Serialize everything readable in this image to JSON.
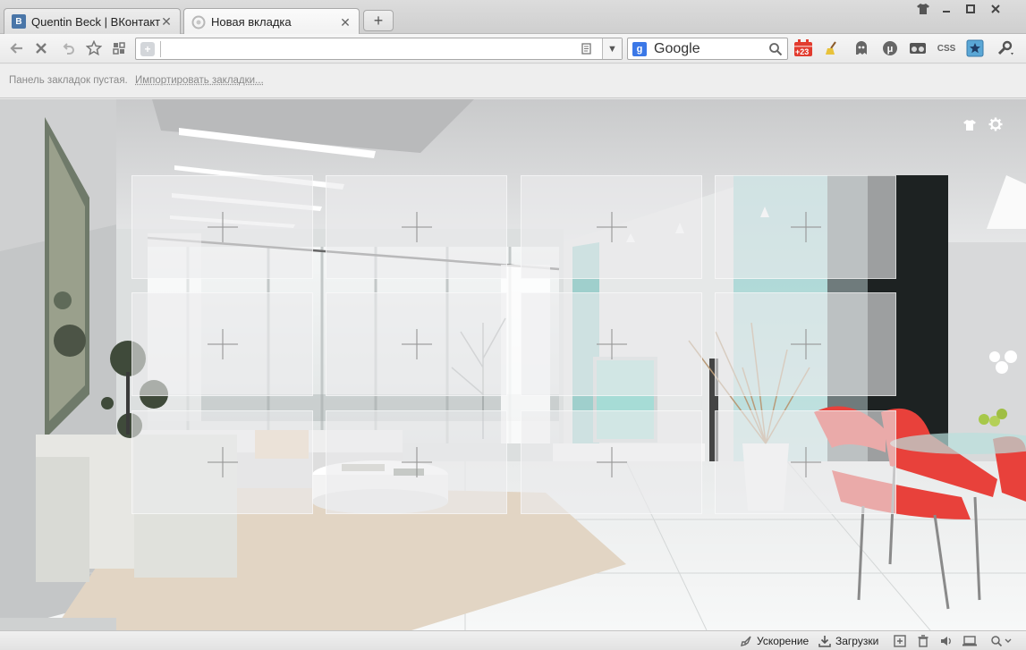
{
  "tabs": [
    {
      "title": "Quentin Beck | ВКонтакте",
      "favicon": "vk-icon",
      "active": false
    },
    {
      "title": "Новая вкладка",
      "favicon": "maxthon-icon",
      "active": true
    }
  ],
  "new_tab_label": "+",
  "window_controls": {
    "skin": "shirt-icon",
    "minimize": "minimize-icon",
    "restore": "restore-icon",
    "close": "close-icon"
  },
  "navbar": {
    "url_value": "",
    "search_engine": "Google",
    "weather_badge": "+23"
  },
  "bookmarks_bar": {
    "empty_text": "Панель закладок пустая.",
    "import_link": "Импортировать закладки..."
  },
  "speed_dial": {
    "rows": 3,
    "cols": 4,
    "tiles": [
      "",
      "",
      "",
      "",
      "",
      "",
      "",
      "",
      "",
      "",
      "",
      ""
    ]
  },
  "statusbar": {
    "accel_label": "Ускорение",
    "downloads_label": "Загрузки",
    "zoom_icon": "zoom-icon"
  },
  "colors": {
    "vk": "#4a76a8",
    "accent_red": "#e04a3b",
    "chair_red": "#e8413b"
  }
}
